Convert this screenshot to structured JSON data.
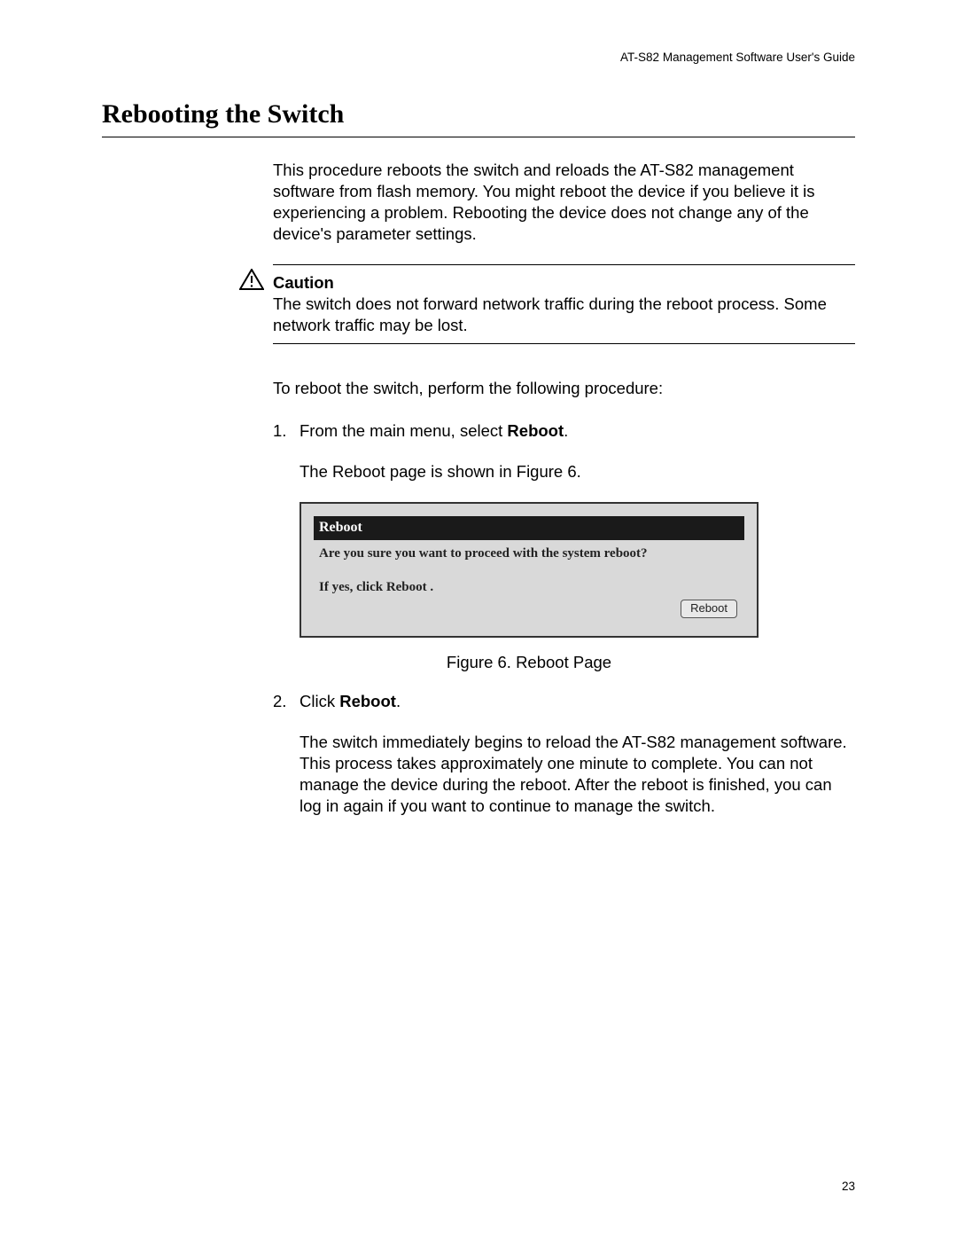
{
  "header": {
    "doc_title": "AT-S82 Management Software User's Guide"
  },
  "section": {
    "title": "Rebooting the Switch"
  },
  "intro": "This procedure reboots the switch and reloads the AT-S82 management software from flash memory. You might reboot the device if you believe it is experiencing a problem. Rebooting the device does not change any of the device's parameter settings.",
  "caution": {
    "label": "Caution",
    "text": "The switch does not forward network traffic during the reboot process. Some network traffic may be lost."
  },
  "proc_intro": "To reboot the switch, perform the following procedure:",
  "steps": {
    "s1": {
      "num": "1.",
      "text_prefix": "From the main menu, select ",
      "text_bold": "Reboot",
      "text_suffix": ".",
      "result": "The Reboot page is shown in Figure 6."
    },
    "s2": {
      "num": "2.",
      "text_prefix": "Click ",
      "text_bold": "Reboot",
      "text_suffix": ".",
      "result": "The switch immediately begins to reload the AT-S82 management software. This process takes approximately one minute to complete. You can not manage the device during the reboot. After the reboot is finished, you can log in again if you want to continue to manage the switch."
    }
  },
  "figure": {
    "titlebar": "Reboot",
    "question": "Are you sure you want to proceed with the system reboot?",
    "instruction": "If yes, click Reboot .",
    "button_label": "Reboot",
    "caption": "Figure 6. Reboot Page"
  },
  "page_number": "23"
}
